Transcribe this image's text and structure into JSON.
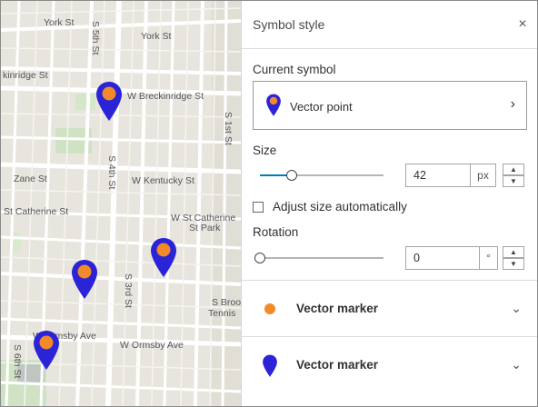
{
  "map": {
    "labels": [
      "York St",
      "York St",
      "S 5th St",
      "kinridge St",
      "W Breckinridge St",
      "S 1st St",
      "S 4th St",
      "W Kentucky St",
      "Zane St",
      "St Catherine St",
      "W St Catherine",
      "St Park",
      "S 3rd St",
      "S Brook",
      "Tennis",
      "W Ormsby Ave",
      "W Ormsby Ave",
      "S 6th St"
    ],
    "pin_color": "#2b24d6",
    "pin_dot_color": "#f28a2a"
  },
  "panel": {
    "title": "Symbol style",
    "close_icon": "×",
    "current_symbol_label": "Current symbol",
    "current_symbol_value": "Vector point",
    "chevron": "›",
    "size_label": "Size",
    "size_value": "42",
    "size_unit": "px",
    "size_slider_fraction": 0.26,
    "adjust_label": "Adjust size automatically",
    "adjust_checked": false,
    "rotation_label": "Rotation",
    "rotation_value": "0",
    "rotation_unit": "°",
    "rotation_slider_fraction": 0,
    "spin_up": "▲",
    "spin_down": "▼",
    "markers": [
      {
        "label": "Vector marker",
        "icon": "orange-dot-icon"
      },
      {
        "label": "Vector marker",
        "icon": "blue-pin-icon"
      }
    ],
    "accent_color": "#007ac2"
  }
}
